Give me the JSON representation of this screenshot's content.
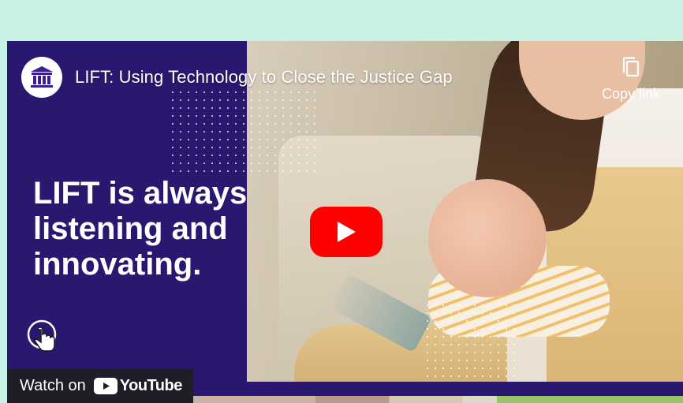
{
  "video": {
    "title": "LIFT: Using Technology to Close the Justice Gap",
    "headline": "LIFT is always\nlistening and\ninnovating.",
    "copy_link_label": "Copy link",
    "watch_on_label": "Watch on",
    "youtube_label": "YouTube"
  },
  "icons": {
    "channel_logo": "courthouse-icon",
    "copy": "copy-icon",
    "play": "play-icon",
    "cursor": "hand-cursor-icon",
    "youtube": "youtube-logo-icon"
  },
  "colors": {
    "page_bg": "#c9f2e6",
    "panel_bg": "#2a1870",
    "play_red": "#ff0000",
    "brand_purple": "#3a1f93"
  }
}
